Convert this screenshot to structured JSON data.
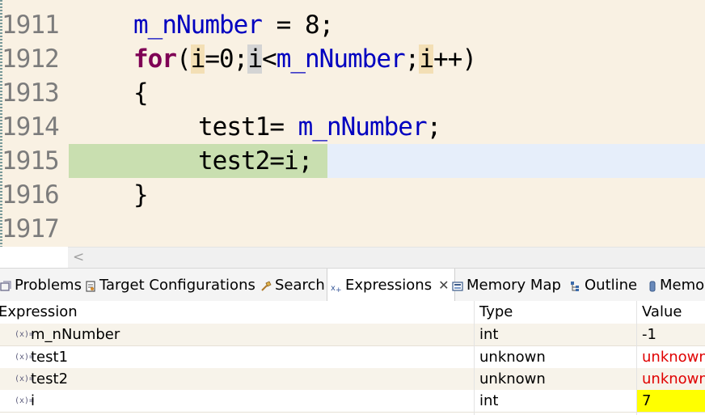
{
  "editor": {
    "lines": [
      {
        "num": "1911",
        "code": [
          {
            "t": "m_nNumber",
            "c": "fld"
          },
          {
            "t": " = 8;",
            "c": ""
          }
        ]
      },
      {
        "num": "1912"
      },
      {
        "num": "1913",
        "code": [
          {
            "t": "{",
            "c": ""
          }
        ]
      },
      {
        "num": "1914",
        "code": [
          {
            "t": "test1= ",
            "c": ""
          },
          {
            "t": "m_nNumber",
            "c": "fld"
          },
          {
            "t": ";",
            "c": ""
          }
        ]
      },
      {
        "num": "1915",
        "code": [
          {
            "t": "test2=i;",
            "c": ""
          }
        ]
      },
      {
        "num": "1916",
        "code": [
          {
            "t": "}",
            "c": ""
          }
        ]
      },
      {
        "num": "1917",
        "code": []
      }
    ],
    "line1912": {
      "kw": "for",
      "p1": "(",
      "i1": "i",
      "p2": "=0;",
      "i2": "i",
      "p3": "<",
      "f": "m_nNumber",
      "p4": ";",
      "i3": "i",
      "p5": "++)"
    },
    "scroll_left": "<"
  },
  "tabs": [
    {
      "label": "Problems",
      "icon": "problems-icon"
    },
    {
      "label": "Target Configurations",
      "icon": "target-config-icon"
    },
    {
      "label": "Search",
      "icon": "search-icon"
    },
    {
      "label": "Expressions",
      "icon": "expressions-icon",
      "active": true,
      "close": "✕"
    },
    {
      "label": "Memory Map",
      "icon": "memory-map-icon"
    },
    {
      "label": "Outline",
      "icon": "outline-icon"
    },
    {
      "label": "Memo",
      "icon": "memory-icon"
    }
  ],
  "table": {
    "headers": [
      "Expression",
      "Type",
      "Value"
    ],
    "var_icon_glyph": "(x)=",
    "rows": [
      {
        "expr": "m_nNumber",
        "type": "int",
        "value": "-1"
      },
      {
        "expr": "test1",
        "type": "unknown",
        "value": "unknown"
      },
      {
        "expr": "test2",
        "type": "unknown",
        "value": "unknown"
      },
      {
        "expr": "i",
        "type": "int",
        "value": "7"
      }
    ]
  },
  "colors": {
    "editor_bg": "#f9f1e3",
    "debug_line": "#c9dfb0",
    "current_line": "#e6eefa",
    "keyword": "#7f0055",
    "field": "#0000c0",
    "error_value": "#e00000",
    "changed_value_bg": "#ffff00"
  }
}
